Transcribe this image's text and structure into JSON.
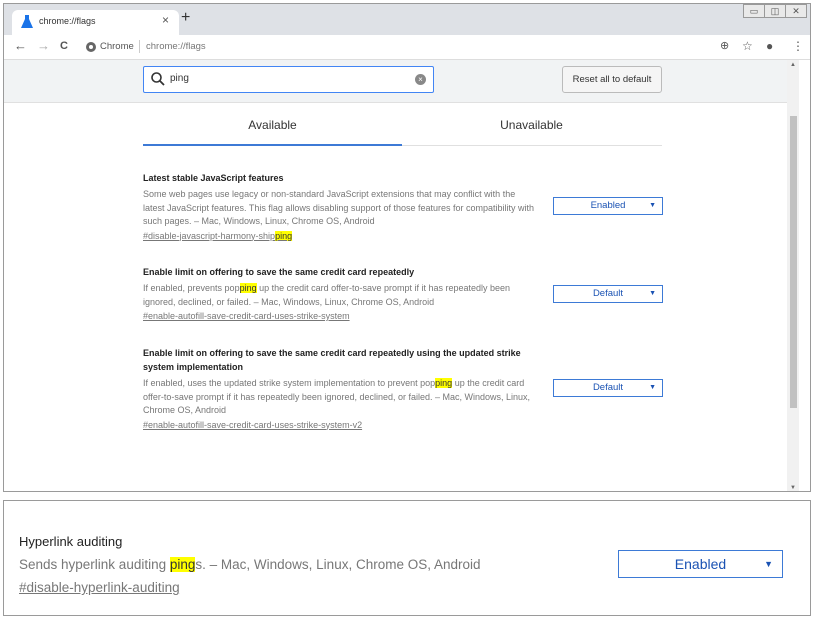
{
  "browser": {
    "tab_title": "chrome://flags",
    "tab_close": "×",
    "new_tab": "+",
    "window_controls": [
      "▭",
      "◫",
      "✕"
    ],
    "site_label": "Chrome",
    "url": "chrome://flags"
  },
  "header": {
    "search_value": "ping",
    "reset_label": "Reset all to default"
  },
  "tabs": [
    {
      "label": "Available",
      "active": true
    },
    {
      "label": "Unavailable",
      "active": false
    }
  ],
  "flags": [
    {
      "title": "Latest stable JavaScript features",
      "desc_before": "Some web pages use legacy or non-standard JavaScript extensions that may conflict with the latest JavaScript features. This flag allows disabling support of those features for compatibility with such pages. – Mac, Windows, Linux, Chrome OS, Android",
      "desc_highlight": "",
      "desc_after": "",
      "link_before": "#disable-javascript-harmony-ship",
      "link_highlight": "ping",
      "link_after": "",
      "value": "Enabled"
    },
    {
      "title": "Enable limit on offering to save the same credit card repeatedly",
      "desc_before": "If enabled, prevents pop",
      "desc_highlight": "ping",
      "desc_after": " up the credit card offer-to-save prompt if it has repeatedly been ignored, declined, or failed. – Mac, Windows, Linux, Chrome OS, Android",
      "link_before": "#enable-autofill-save-credit-card-uses-strike-system",
      "link_highlight": "",
      "link_after": "",
      "value": "Default"
    },
    {
      "title": "Enable limit on offering to save the same credit card repeatedly using the updated strike system implementation",
      "desc_before": "If enabled, uses the updated strike system implementation to prevent pop",
      "desc_highlight": "ping",
      "desc_after": " up the credit card offer-to-save prompt if it has repeatedly been ignored, declined, or failed. – Mac, Windows, Linux, Chrome OS, Android",
      "link_before": "#enable-autofill-save-credit-card-uses-strike-system-v2",
      "link_highlight": "",
      "link_after": "",
      "value": "Default"
    }
  ],
  "zoom": {
    "title": "Hyperlink auditing",
    "desc_before": "Sends hyperlink auditing ",
    "desc_highlight": "ping",
    "desc_after": "s. – Mac, Windows, Linux, Chrome OS, Android",
    "link": "#disable-hyperlink-auditing",
    "value": "Enabled"
  },
  "icons": {
    "back": "←",
    "forward": "→",
    "reload": "C",
    "zoom": "⊕",
    "star": "☆",
    "account": "●",
    "menu": "⋮",
    "select_arrow": "▼",
    "clear": "×",
    "scroll_up": "▲",
    "scroll_down": "▼"
  },
  "colors": {
    "accent": "#3d7ad6",
    "highlight": "#ffff00",
    "tabstrip": "#dee1e6"
  }
}
